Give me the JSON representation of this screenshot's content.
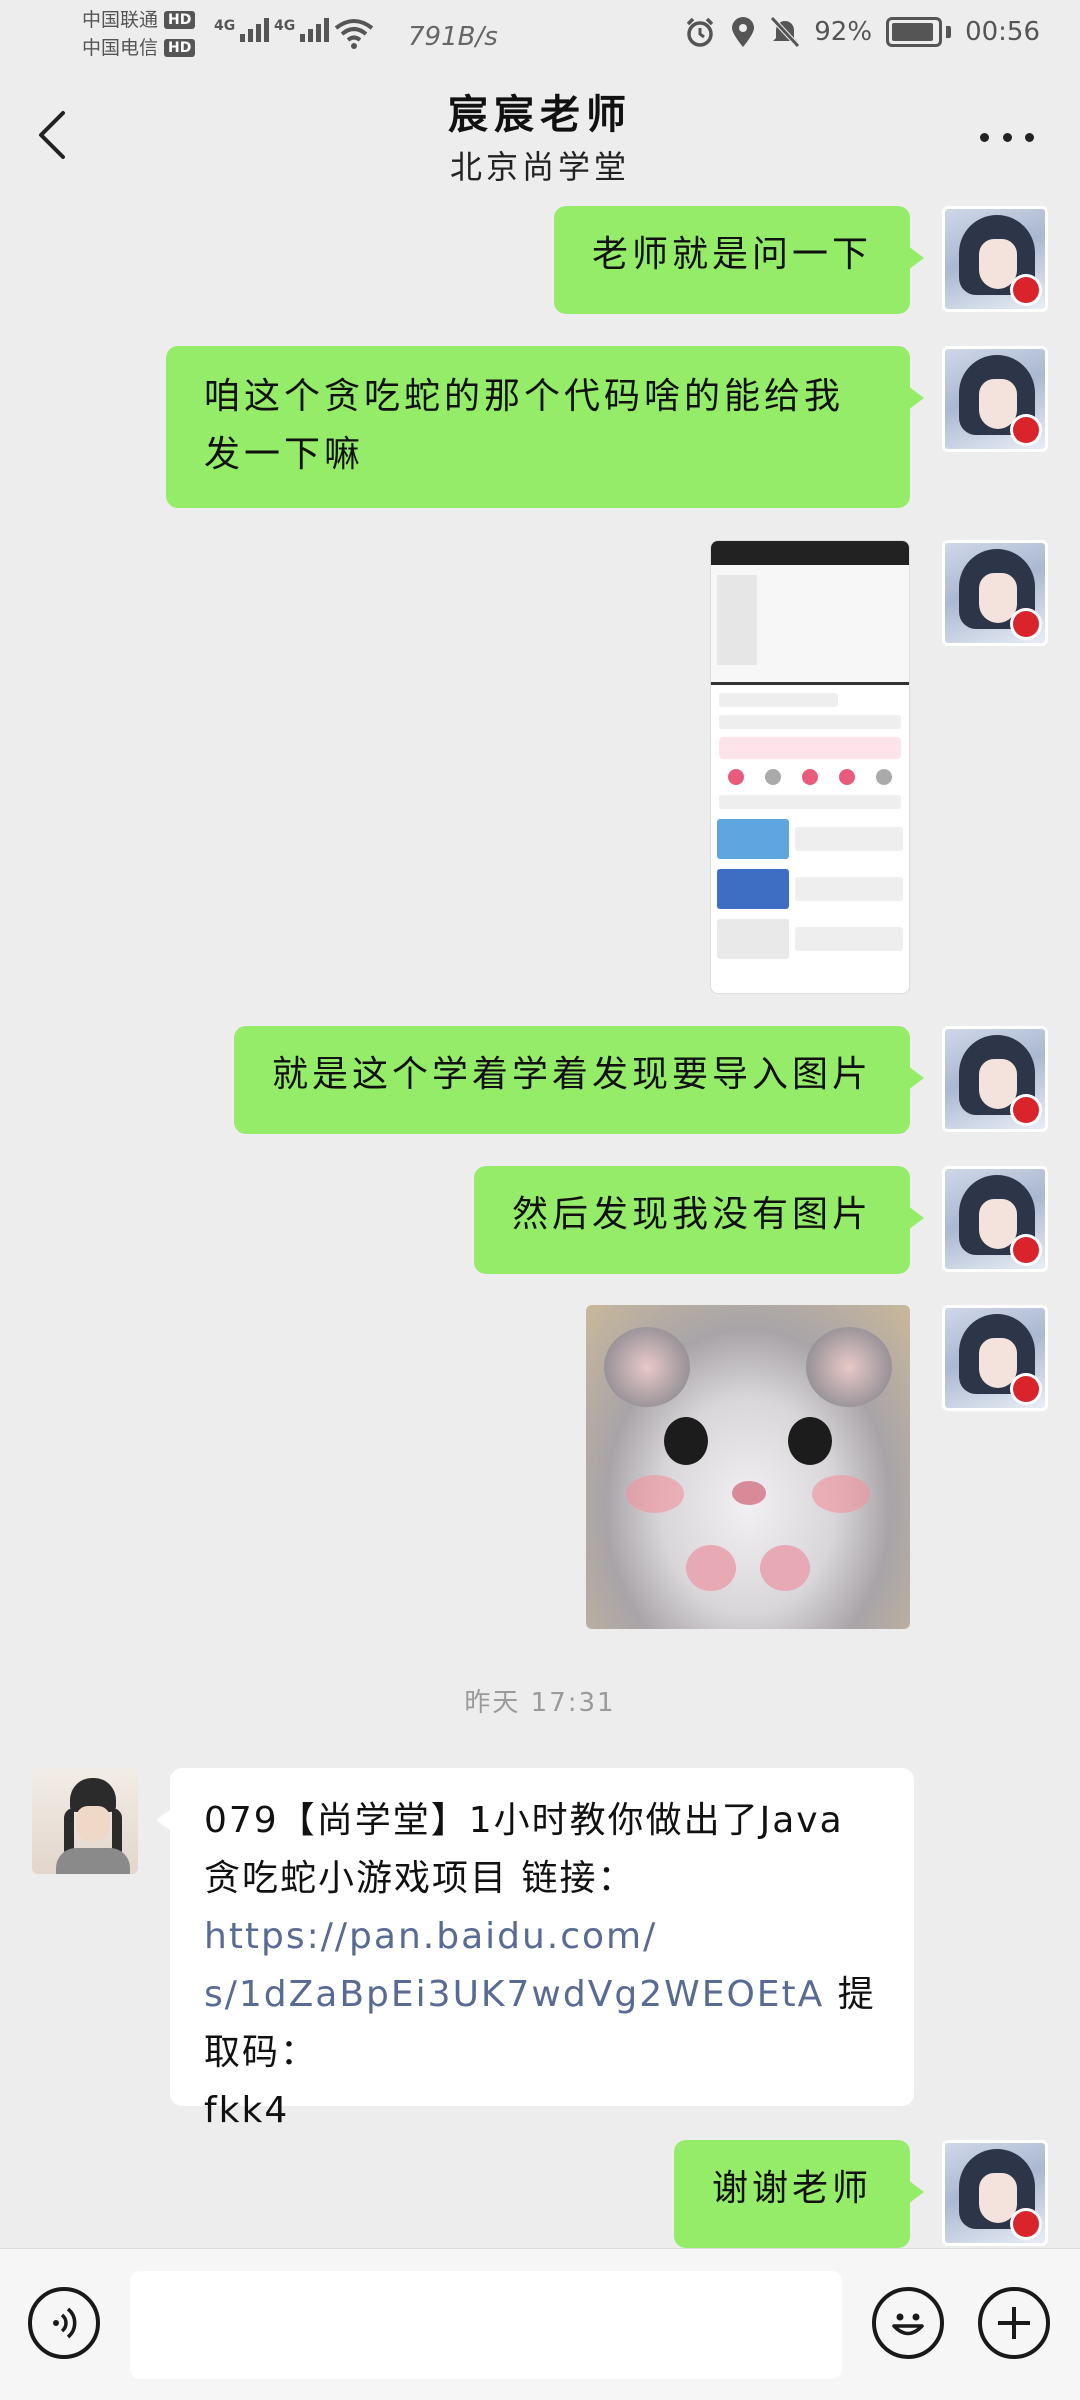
{
  "status_bar": {
    "carrier_1": "中国联通",
    "carrier_2": "中国电信",
    "hd_badge": "HD",
    "network_1": "4G",
    "network_2": "4G",
    "speed": "791B/s",
    "battery": "92%",
    "battery_level": 0.92,
    "time": "00:56",
    "icons": [
      "alarm-icon",
      "location-icon",
      "mute-icon",
      "wifi-icon",
      "battery-icon"
    ]
  },
  "header": {
    "title": "宸宸老师",
    "subtitle": "北京尚学堂",
    "back_icon": "chevron-left-icon",
    "more_icon": "more-dots-icon"
  },
  "messages": [
    {
      "from": "me",
      "type": "text",
      "text": "老师就是问一下"
    },
    {
      "from": "me",
      "type": "text",
      "text": "咱这个贪吃蛇的那个代码啥的能给我发一下嘛"
    },
    {
      "from": "me",
      "type": "image",
      "content": "screenshot"
    },
    {
      "from": "me",
      "type": "text",
      "text": "就是这个学着学着发现要导入图片"
    },
    {
      "from": "me",
      "type": "text",
      "text": "然后发现我没有图片"
    },
    {
      "from": "me",
      "type": "image",
      "content": "hamster sticker"
    },
    {
      "from": "teacher",
      "type": "text",
      "text_before": "079【尚学堂】1小时教你做出了Java贪吃蛇小游戏项目 链接：",
      "link_line_1": "https://pan.baidu.com/",
      "link_line_2": "s/1dZaBpEi3UK7wdVg2WEOEtA",
      "text_after_1": " 提取码：",
      "text_after_2": "fkk4"
    },
    {
      "from": "me",
      "type": "text",
      "text": "谢谢老师"
    }
  ],
  "timestamp": "昨天 17:31",
  "input_bar": {
    "voice_icon": "voice-icon",
    "emoji_icon": "emoji-icon",
    "plus_icon": "plus-icon",
    "input_value": ""
  },
  "colors": {
    "my_bubble": "#95ec69",
    "their_bubble": "#ffffff",
    "background": "#ededed",
    "link": "#576b95"
  }
}
